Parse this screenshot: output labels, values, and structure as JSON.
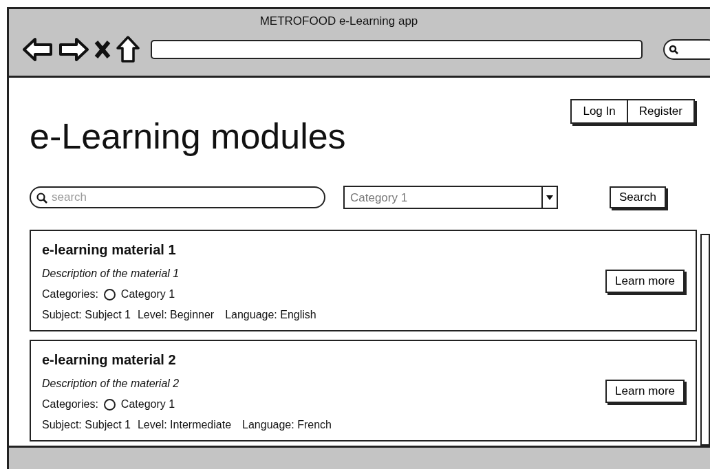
{
  "window": {
    "title": "METROFOOD e-Learning app"
  },
  "header": {
    "title": "e-Learning modules",
    "buttons": [
      "Log In",
      "Register"
    ]
  },
  "filters": {
    "search": {
      "placeholder": "search"
    },
    "category": {
      "value": "Category 1"
    },
    "button": "Search"
  },
  "materials": [
    {
      "title": "e-learning material 1",
      "description": "Description of the material 1",
      "categories_label": "Categories:",
      "categories": [
        {
          "label": "Category 1",
          "checked": false
        }
      ],
      "subject": "Subject: Subject 1",
      "level": "Level: Beginner",
      "language": "Language: English",
      "button": "Learn more"
    },
    {
      "title": "e-learning material 2",
      "description": "Description of the material 2",
      "categories_label": "Categories:",
      "categories": [
        {
          "label": "Category 1",
          "checked": false
        }
      ],
      "subject": "Subject: Subject 1",
      "level": "Level: Intermediate",
      "language": "Language: French",
      "button": "Learn more"
    }
  ]
}
